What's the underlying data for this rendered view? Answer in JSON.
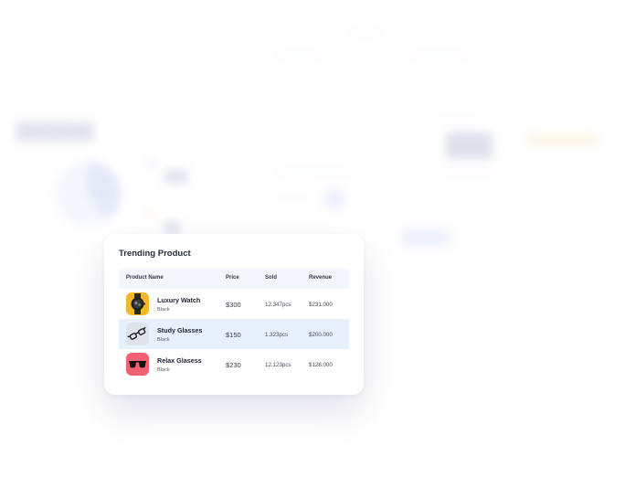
{
  "card": {
    "title": "Trending Product",
    "columns": [
      "Product Name",
      "Price",
      "Sold",
      "Revenue"
    ],
    "rows": [
      {
        "name": "Luxury Watch",
        "color": "Black",
        "price": "$300",
        "sold": "12.347pcs",
        "revenue": "$231.000",
        "icon": "watch-icon",
        "thumb_bg": "#f5b72a"
      },
      {
        "name": "Study Glasses",
        "color": "Black",
        "price": "$150",
        "sold": "1.323pcs",
        "revenue": "$200.000",
        "icon": "glasses-icon",
        "thumb_bg": "#dfe3ea"
      },
      {
        "name": "Relax Glasess",
        "color": "Black",
        "price": "$230",
        "sold": "12.123pcs",
        "revenue": "$128.000",
        "icon": "sunglasses-icon",
        "thumb_bg": "#f26172"
      }
    ],
    "highlight_color": "#e7f0fc",
    "header_color": "#f3f6fd"
  }
}
